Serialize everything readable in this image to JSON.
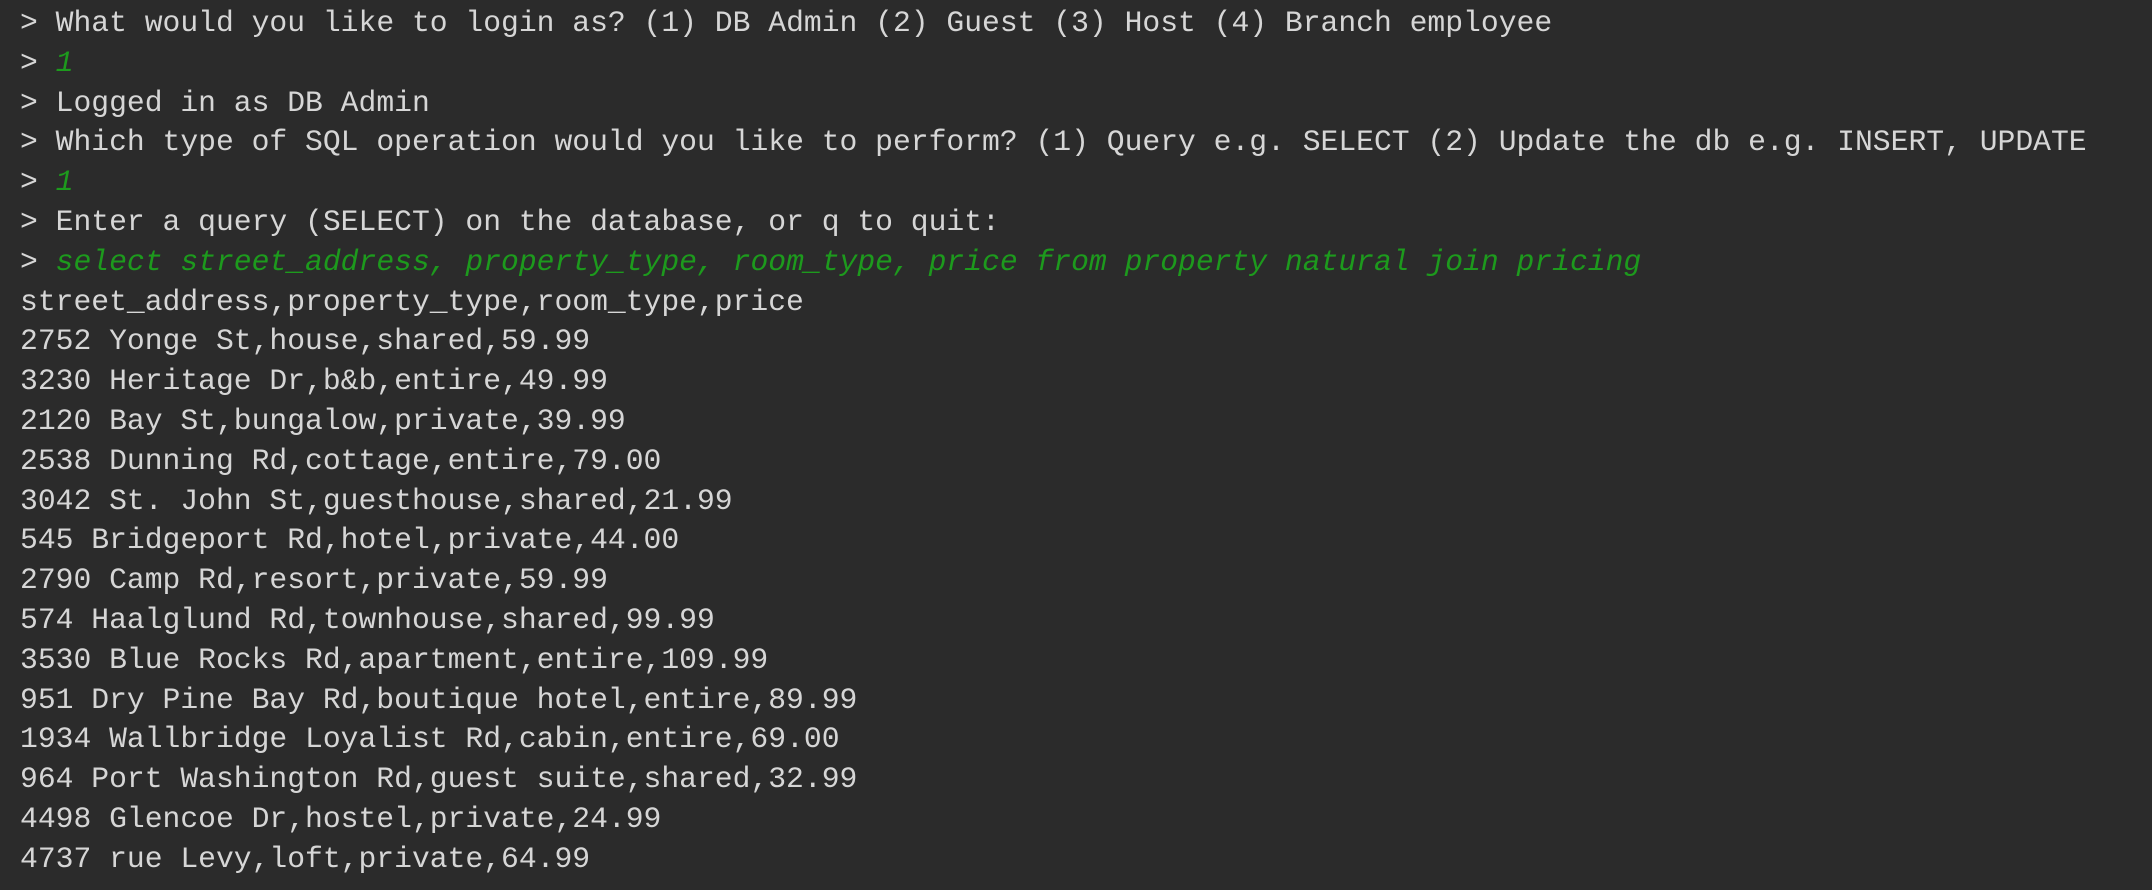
{
  "terminal": {
    "prompt_symbol": "> ",
    "session": [
      {
        "kind": "prompt",
        "text": "What would you like to login as? (1) DB Admin (2) Guest (3) Host (4) Branch employee"
      },
      {
        "kind": "input",
        "text": "1"
      },
      {
        "kind": "prompt",
        "text": "Logged in as DB Admin"
      },
      {
        "kind": "prompt",
        "text": "Which type of SQL operation would you like to perform? (1) Query e.g. SELECT (2) Update the db e.g. INSERT, UPDATE"
      },
      {
        "kind": "input",
        "text": "1"
      },
      {
        "kind": "prompt",
        "text": "Enter a query (SELECT) on the database, or q to quit:"
      },
      {
        "kind": "input",
        "text": "select street_address, property_type, room_type, price from property natural join pricing"
      }
    ],
    "result_header": "street_address,property_type,room_type,price",
    "result_rows": [
      "2752 Yonge St,house,shared,59.99",
      "3230 Heritage Dr,b&b,entire,49.99",
      "2120 Bay St,bungalow,private,39.99",
      "2538 Dunning Rd,cottage,entire,79.00",
      "3042 St. John St,guesthouse,shared,21.99",
      "545 Bridgeport Rd,hotel,private,44.00",
      "2790 Camp Rd,resort,private,59.99",
      "574 Haalglund Rd,townhouse,shared,99.99",
      "3530 Blue Rocks Rd,apartment,entire,109.99",
      "951 Dry Pine Bay Rd,boutique hotel,entire,89.99",
      "1934 Wallbridge Loyalist Rd,cabin,entire,69.00",
      "964 Port Washington Rd,guest suite,shared,32.99",
      "4498 Glencoe Dr,hostel,private,24.99",
      "4737 rue Levy,loft,private,64.99"
    ],
    "colors": {
      "background": "#2b2b2b",
      "text": "#d6d6d6",
      "input": "#1d9a1d"
    }
  }
}
